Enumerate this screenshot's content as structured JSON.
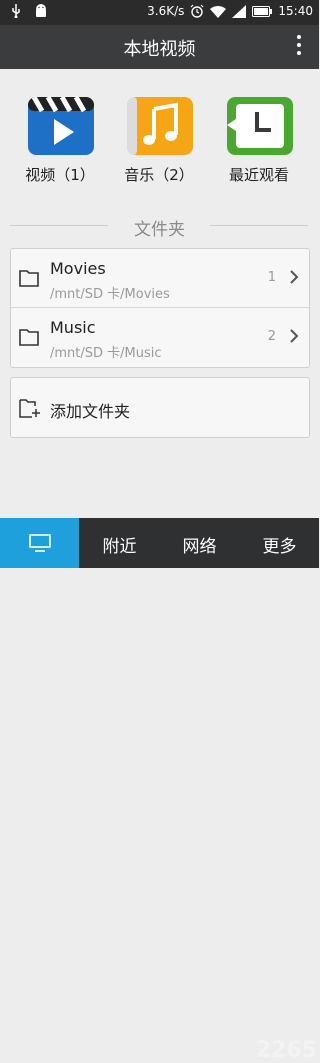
{
  "statusbar": {
    "network_speed": "3.6K/s",
    "time": "15:40"
  },
  "header": {
    "title": "本地视频"
  },
  "categories": [
    {
      "label": "视频（1）",
      "icon": "video-icon"
    },
    {
      "label": "音乐（2）",
      "icon": "music-icon"
    },
    {
      "label": "最近观看",
      "icon": "recent-icon"
    }
  ],
  "section_title": "文件夹",
  "folders": [
    {
      "name": "Movies",
      "path": "/mnt/SD 卡/Movies",
      "count": "1"
    },
    {
      "name": "Music",
      "path": "/mnt/SD 卡/Music",
      "count": "2"
    }
  ],
  "add_folder_label": "添加文件夹",
  "tabs": [
    {
      "label": "",
      "icon": "monitor-icon",
      "active": true
    },
    {
      "label": "附近",
      "active": false
    },
    {
      "label": "网络",
      "active": false
    },
    {
      "label": "更多",
      "active": false
    }
  ],
  "watermark": "2265",
  "colors": {
    "accent": "#1ea0dc",
    "titlebar": "#3a3c3e",
    "tabbar": "#2e3032"
  }
}
